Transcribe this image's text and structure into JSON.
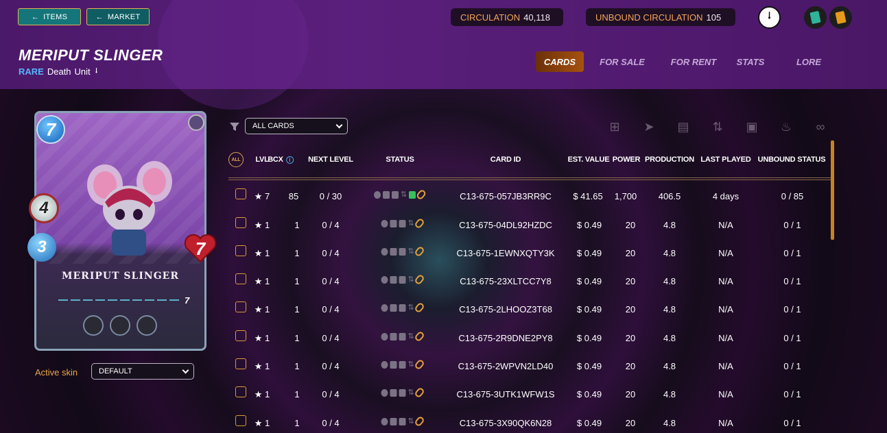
{
  "nav": {
    "items_label": "ITEMS",
    "market_label": "MARKET"
  },
  "stats": {
    "circulation_label": "CIRCULATION",
    "circulation_value": "40,118",
    "unbound_label": "UNBOUND CIRCULATION",
    "unbound_value": "105"
  },
  "icons": {
    "logo": "splinterlands-logo-icon",
    "cards_green": "green-cards-icon",
    "cards_orange": "orange-cards-icon"
  },
  "card": {
    "name": "MERIPUT SLINGER",
    "rarity": "RARE",
    "element": "Death",
    "type": "Unit",
    "mana": "7",
    "attack": "4",
    "speed": "3",
    "health": "7",
    "level": "7",
    "art_name": "MERIPUT SLINGER"
  },
  "tabs": [
    "CARDS",
    "FOR SALE",
    "FOR RENT",
    "STATS",
    "LORE"
  ],
  "skin": {
    "label": "Active skin",
    "value": "DEFAULT"
  },
  "filter": {
    "value": "ALL CARDS"
  },
  "table": {
    "all_badge": "ALL",
    "headers": [
      "LVL",
      "BCX",
      "NEXT LEVEL",
      "STATUS",
      "CARD ID",
      "EST. VALUE",
      "POWER",
      "PRODUCTION",
      "LAST PLAYED",
      "UNBOUND STATUS"
    ],
    "rows": [
      {
        "lvl": "★ 7",
        "bcx": "85",
        "next": "0 / 30",
        "id": "C13-675-057JB3RR9C",
        "value": "$ 41.65",
        "power": "1,700",
        "prod": "406.5",
        "played": "4 days",
        "unbound": "0 / 85",
        "green": true
      },
      {
        "lvl": "★ 1",
        "bcx": "1",
        "next": "0 / 4",
        "id": "C13-675-04DL92HZDC",
        "value": "$ 0.49",
        "power": "20",
        "prod": "4.8",
        "played": "N/A",
        "unbound": "0 / 1"
      },
      {
        "lvl": "★ 1",
        "bcx": "1",
        "next": "0 / 4",
        "id": "C13-675-1EWNXQTY3K",
        "value": "$ 0.49",
        "power": "20",
        "prod": "4.8",
        "played": "N/A",
        "unbound": "0 / 1"
      },
      {
        "lvl": "★ 1",
        "bcx": "1",
        "next": "0 / 4",
        "id": "C13-675-23XLTCC7Y8",
        "value": "$ 0.49",
        "power": "20",
        "prod": "4.8",
        "played": "N/A",
        "unbound": "0 / 1"
      },
      {
        "lvl": "★ 1",
        "bcx": "1",
        "next": "0 / 4",
        "id": "C13-675-2LHOOZ3T68",
        "value": "$ 0.49",
        "power": "20",
        "prod": "4.8",
        "played": "N/A",
        "unbound": "0 / 1"
      },
      {
        "lvl": "★ 1",
        "bcx": "1",
        "next": "0 / 4",
        "id": "C13-675-2R9DNE2PY8",
        "value": "$ 0.49",
        "power": "20",
        "prod": "4.8",
        "played": "N/A",
        "unbound": "0 / 1"
      },
      {
        "lvl": "★ 1",
        "bcx": "1",
        "next": "0 / 4",
        "id": "C13-675-2WPVN2LD40",
        "value": "$ 0.49",
        "power": "20",
        "prod": "4.8",
        "played": "N/A",
        "unbound": "0 / 1"
      },
      {
        "lvl": "★ 1",
        "bcx": "1",
        "next": "0 / 4",
        "id": "C13-675-3UTK1WFW1S",
        "value": "$ 0.49",
        "power": "20",
        "prod": "4.8",
        "played": "N/A",
        "unbound": "0 / 1"
      },
      {
        "lvl": "★ 1",
        "bcx": "1",
        "next": "0 / 4",
        "id": "C13-675-3X90QK6N28",
        "value": "$ 0.49",
        "power": "20",
        "prod": "4.8",
        "played": "N/A",
        "unbound": "0 / 1"
      }
    ]
  },
  "colors": {
    "accent_orange": "#f2a65a",
    "teal_button": "#14767a",
    "rare_blue": "#55b6ff",
    "gold": "#d99b3a"
  }
}
